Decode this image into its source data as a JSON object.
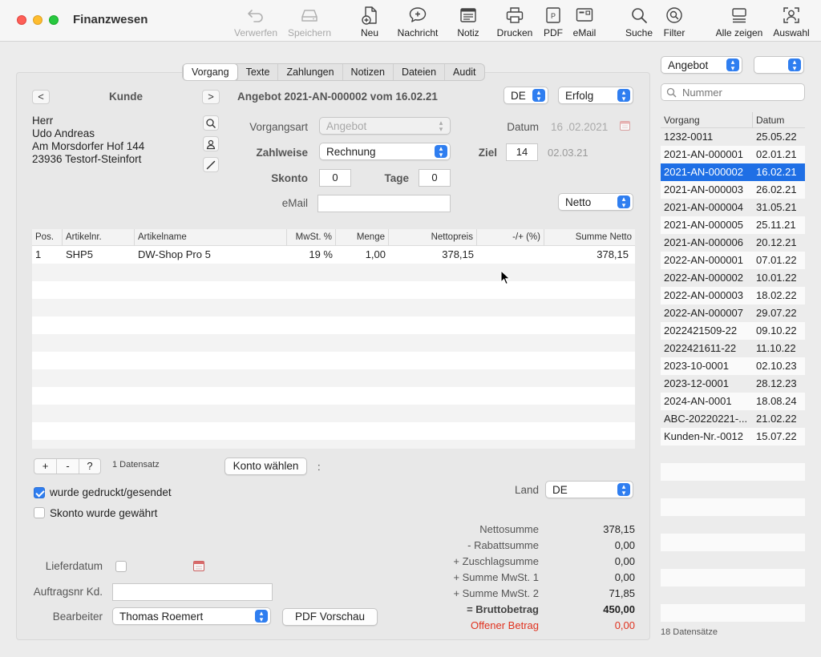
{
  "window": {
    "title": "Finanzwesen"
  },
  "toolbar": {
    "verwerfen": "Verwerfen",
    "speichern": "Speichern",
    "neu": "Neu",
    "nachricht": "Nachricht",
    "notiz": "Notiz",
    "drucken": "Drucken",
    "pdf": "PDF",
    "email": "eMail",
    "suche": "Suche",
    "filter": "Filter",
    "alle_zeigen": "Alle zeigen",
    "auswahl": "Auswahl"
  },
  "tabs": [
    "Vorgang",
    "Texte",
    "Zahlungen",
    "Notizen",
    "Dateien",
    "Audit"
  ],
  "customer": {
    "prev": "<",
    "next": ">",
    "label": "Kunde",
    "address": [
      "Herr",
      "Udo Andreas",
      "Am Morsdorfer Hof 144",
      "23936 Testorf-Steinfort"
    ]
  },
  "document": {
    "title": "Angebot 2021-AN-000002 vom 16.02.21",
    "language": "DE",
    "status": "Erfolg",
    "vorgangsart_label": "Vorgangsart",
    "vorgangsart": "Angebot",
    "datum_label": "Datum",
    "datum": "16 .02.2021",
    "zahlweise_label": "Zahlweise",
    "zahlweise": "Rechnung",
    "ziel_label": "Ziel",
    "ziel": "14",
    "ziel_date": "02.03.21",
    "skonto_label": "Skonto",
    "skonto": "0",
    "tage_label": "Tage",
    "tage": "0",
    "email_label": "eMail",
    "email": "",
    "netto": "Netto"
  },
  "table": {
    "headers": [
      "Pos.",
      "Artikelnr.",
      "Artikelname",
      "MwSt. %",
      "Menge",
      "Nettopreis",
      "-/+ (%)",
      "Summe Netto"
    ],
    "rows": [
      [
        "1",
        "SHP5",
        "DW-Shop Pro 5",
        "19 %",
        "1,00",
        "378,15",
        "",
        "378,15"
      ]
    ],
    "add": "+",
    "remove": "-",
    "help": "?",
    "count": "1 Datensatz",
    "konto_button": "Konto wählen",
    "colon": ":"
  },
  "options": {
    "gedruckt": "wurde gedruckt/gesendet",
    "skonto_gewaehrt": "Skonto wurde gewährt",
    "land_label": "Land",
    "land": "DE"
  },
  "footer": {
    "lieferdatum_label": "Lieferdatum",
    "auftragsnr_label": "Auftragsnr Kd.",
    "auftragsnr": "",
    "bearbeiter_label": "Bearbeiter",
    "bearbeiter": "Thomas Roemert",
    "pdf_vorschau": "PDF Vorschau"
  },
  "sums": [
    {
      "label": "Nettosumme",
      "value": "378,15"
    },
    {
      "label": "- Rabattsumme",
      "value": "0,00"
    },
    {
      "label": "+ Zuschlagsumme",
      "value": "0,00"
    },
    {
      "label": "+ Summe MwSt. 1",
      "value": "0,00"
    },
    {
      "label": "+ Summe MwSt. 2",
      "value": "71,85"
    },
    {
      "label": "= Bruttobetrag",
      "value": "450,00"
    },
    {
      "label": "Offener Betrag",
      "value": "0,00"
    }
  ],
  "sidebar": {
    "type": "Angebot",
    "second": "",
    "search_placeholder": "Nummer",
    "col_vorgang": "Vorgang",
    "col_datum": "Datum",
    "rows": [
      [
        "1232-0011",
        "25.05.22"
      ],
      [
        "2021-AN-000001",
        "02.01.21"
      ],
      [
        "2021-AN-000002",
        "16.02.21"
      ],
      [
        "2021-AN-000003",
        "26.02.21"
      ],
      [
        "2021-AN-000004",
        "31.05.21"
      ],
      [
        "2021-AN-000005",
        "25.11.21"
      ],
      [
        "2021-AN-000006",
        "20.12.21"
      ],
      [
        "2022-AN-000001",
        "07.01.22"
      ],
      [
        "2022-AN-000002",
        "10.01.22"
      ],
      [
        "2022-AN-000003",
        "18.02.22"
      ],
      [
        "2022-AN-000007",
        "29.07.22"
      ],
      [
        "2022421509-22",
        "09.10.22"
      ],
      [
        "2022421611-22",
        "11.10.22"
      ],
      [
        "2023-10-0001",
        "02.10.23"
      ],
      [
        "2023-12-0001",
        "28.12.23"
      ],
      [
        "2024-AN-0001",
        "18.08.24"
      ],
      [
        "ABC-20220221-...",
        "21.02.22"
      ],
      [
        "Kunden-Nr.-0012",
        "15.07.22"
      ]
    ],
    "selected_index": 2,
    "count": "18 Datensätze"
  },
  "colors": {
    "accent": "#2f7ef0",
    "selection": "#1f6fe5",
    "error": "#e0321f"
  }
}
